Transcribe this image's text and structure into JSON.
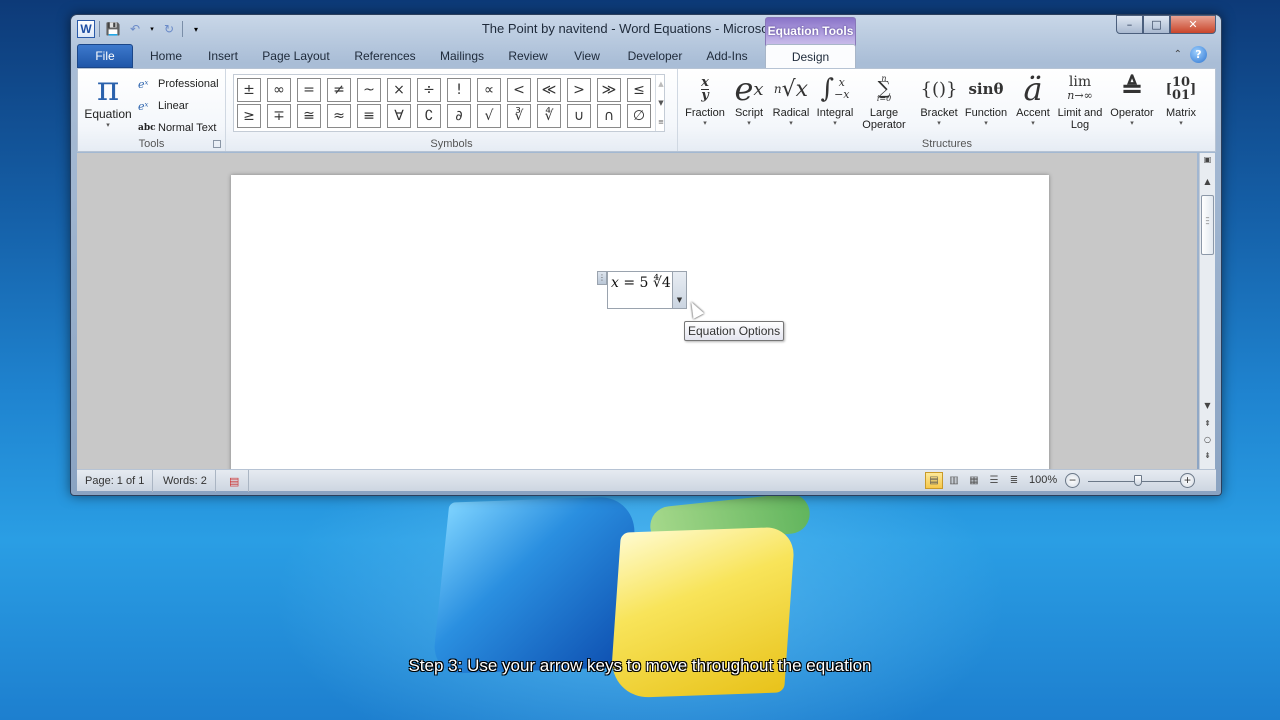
{
  "window": {
    "title": "The Point by navitend - Word Equations  -  Microsoft Word",
    "context_tab_group": "Equation Tools",
    "buttons": {
      "minimize": "–",
      "maximize": "□",
      "close": "✕"
    }
  },
  "quick_access": {
    "app_icon": "W",
    "items": [
      "save-icon",
      "undo-icon",
      "redo-icon",
      "customize-icon"
    ]
  },
  "tabs": [
    {
      "label": "File"
    },
    {
      "label": "Home"
    },
    {
      "label": "Insert"
    },
    {
      "label": "Page Layout"
    },
    {
      "label": "References"
    },
    {
      "label": "Mailings"
    },
    {
      "label": "Review"
    },
    {
      "label": "View"
    },
    {
      "label": "Developer"
    },
    {
      "label": "Add-Ins"
    },
    {
      "label": "Design",
      "active": true
    }
  ],
  "ribbon": {
    "tools": {
      "label": "Tools",
      "equation": "Equation",
      "equation_glyph": "π",
      "options": [
        {
          "label": "Professional",
          "icon": "eˣ"
        },
        {
          "label": "Linear",
          "icon": "eˣ"
        },
        {
          "label": "Normal Text",
          "icon": "abc"
        }
      ]
    },
    "symbols": {
      "label": "Symbols",
      "row1": [
        "±",
        "∞",
        "=",
        "≠",
        "~",
        "×",
        "÷",
        "!",
        "∝",
        "<",
        "≪",
        ">",
        "≫",
        "≤"
      ],
      "row2": [
        "≥",
        "∓",
        "≅",
        "≈",
        "≡",
        "∀",
        "∁",
        "∂",
        "√",
        "∛",
        "∜",
        "∪",
        "∩",
        "∅"
      ]
    },
    "structures": {
      "label": "Structures",
      "items": [
        {
          "label": "Fraction",
          "glyph": "x/y"
        },
        {
          "label": "Script",
          "glyph": "eˣ"
        },
        {
          "label": "Radical",
          "glyph": "ⁿ√x"
        },
        {
          "label": "Integral",
          "glyph": "∫"
        },
        {
          "label": "Large Operator",
          "glyph": "∑"
        },
        {
          "label": "Bracket",
          "glyph": "{()}"
        },
        {
          "label": "Function",
          "glyph": "sinθ"
        },
        {
          "label": "Accent",
          "glyph": "ä"
        },
        {
          "label": "Limit and Log",
          "glyph": "lim"
        },
        {
          "label": "Operator",
          "glyph": "≜"
        },
        {
          "label": "Matrix",
          "glyph": "[10 01]"
        }
      ]
    }
  },
  "document": {
    "equation": {
      "lhs": "x",
      "eq": " = 5 ",
      "radical": "∜4"
    },
    "tooltip": "Equation Options"
  },
  "status": {
    "page": "Page: 1 of 1",
    "words": "Words: 2",
    "zoom": "100%",
    "zoom_level_percent": 100
  },
  "subtitle": "Step 3: Use your arrow keys to move throughout the equation"
}
